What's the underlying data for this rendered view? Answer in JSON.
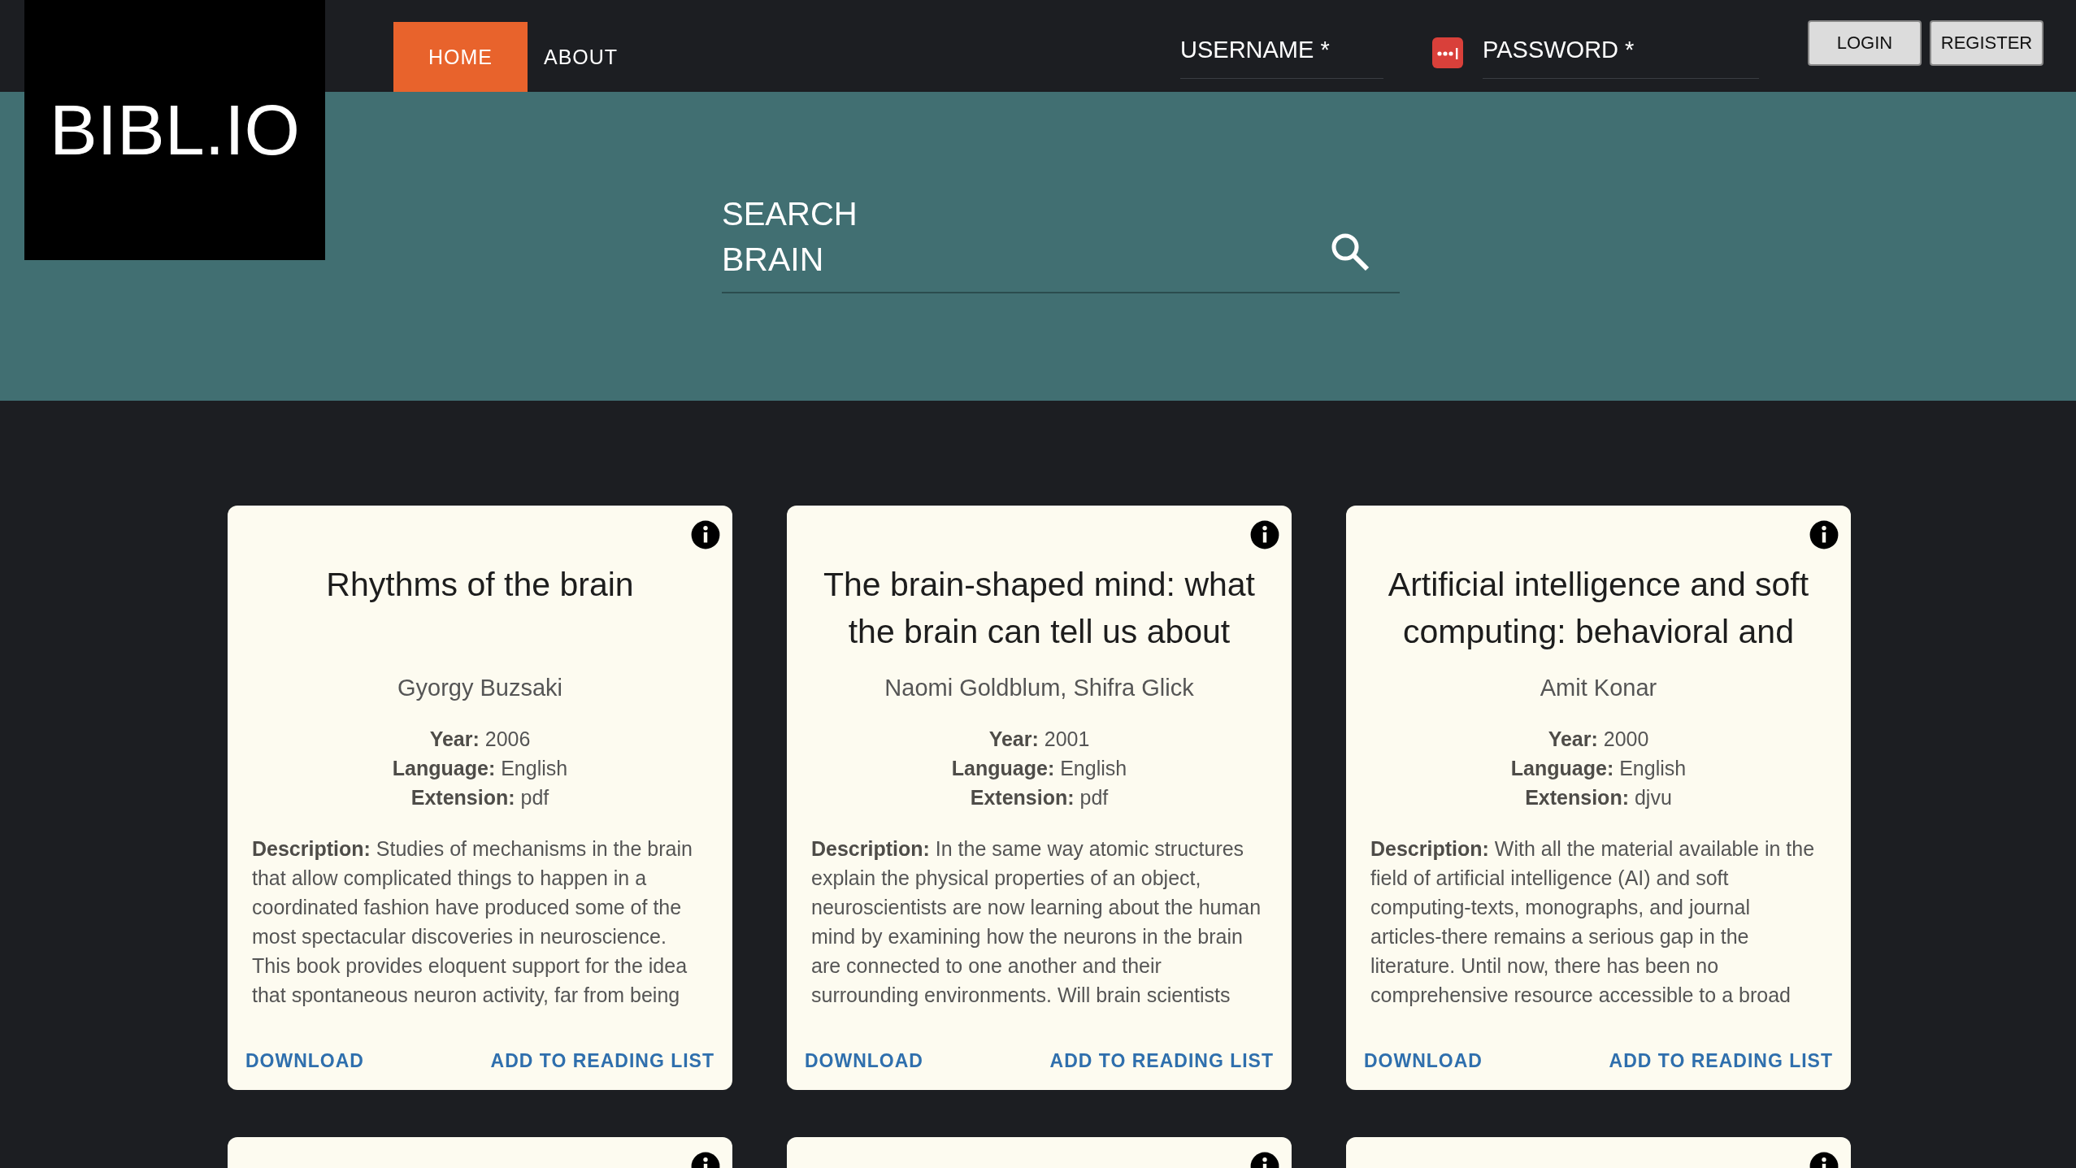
{
  "logo": "BIBL.IO",
  "nav": [
    {
      "label": "HOME",
      "selected": true
    },
    {
      "label": "ABOUT",
      "selected": false
    }
  ],
  "login_form": {
    "username_label": "USERNAME *",
    "password_label": "PASSWORD *",
    "buttons": [
      "LOGIN",
      "REGISTER"
    ]
  },
  "search": {
    "label": "SEARCH",
    "value": "BRAIN"
  },
  "cards": [
    {
      "kind": "full",
      "title": "Rhythms of the brain",
      "author": "Gyorgy Buzsaki",
      "meta": [
        "**Year:** 2006",
        "**Language:** English",
        "**Extension:** pdf"
      ],
      "description": "**Description:** Studies of mechanisms in the brain that allow complicated things to happen in a coordinated fashion have produced some of the most spectacular discoveries in neuroscience. This book provides eloquent support for the idea that spontaneous neuron activity, far from being",
      "actions": [
        "DOWNLOAD",
        "ADD TO READING LIST"
      ]
    },
    {
      "kind": "full",
      "title": "The brain-shaped mind: what the brain can tell us about",
      "author": "Naomi Goldblum, Shifra Glick",
      "meta": [
        "**Year:** 2001",
        "**Language:** English",
        "**Extension:** pdf"
      ],
      "description": "**Description:** In the same way atomic structures explain the physical properties of an object, neuroscientists are now learning about the human mind by examining how the neurons in the brain are connected to one another and their surrounding environments. Will brain scientists",
      "actions": [
        "DOWNLOAD",
        "ADD TO READING LIST"
      ]
    },
    {
      "kind": "full",
      "title": "Artificial intelligence and soft computing: behavioral and",
      "author": "Amit Konar",
      "meta": [
        "**Year:** 2000",
        "**Language:** English",
        "**Extension:** djvu"
      ],
      "description": "**Description:** With all the material available in the field of artificial intelligence (AI) and soft computing-texts, monographs, and journal articles-there remains a serious gap in the literature. Until now, there has been no comprehensive resource accessible to a broad",
      "actions": [
        "DOWNLOAD",
        "ADD TO READING LIST"
      ]
    },
    {
      "kind": "cut"
    },
    {
      "kind": "cut"
    },
    {
      "kind": "cut"
    }
  ]
}
